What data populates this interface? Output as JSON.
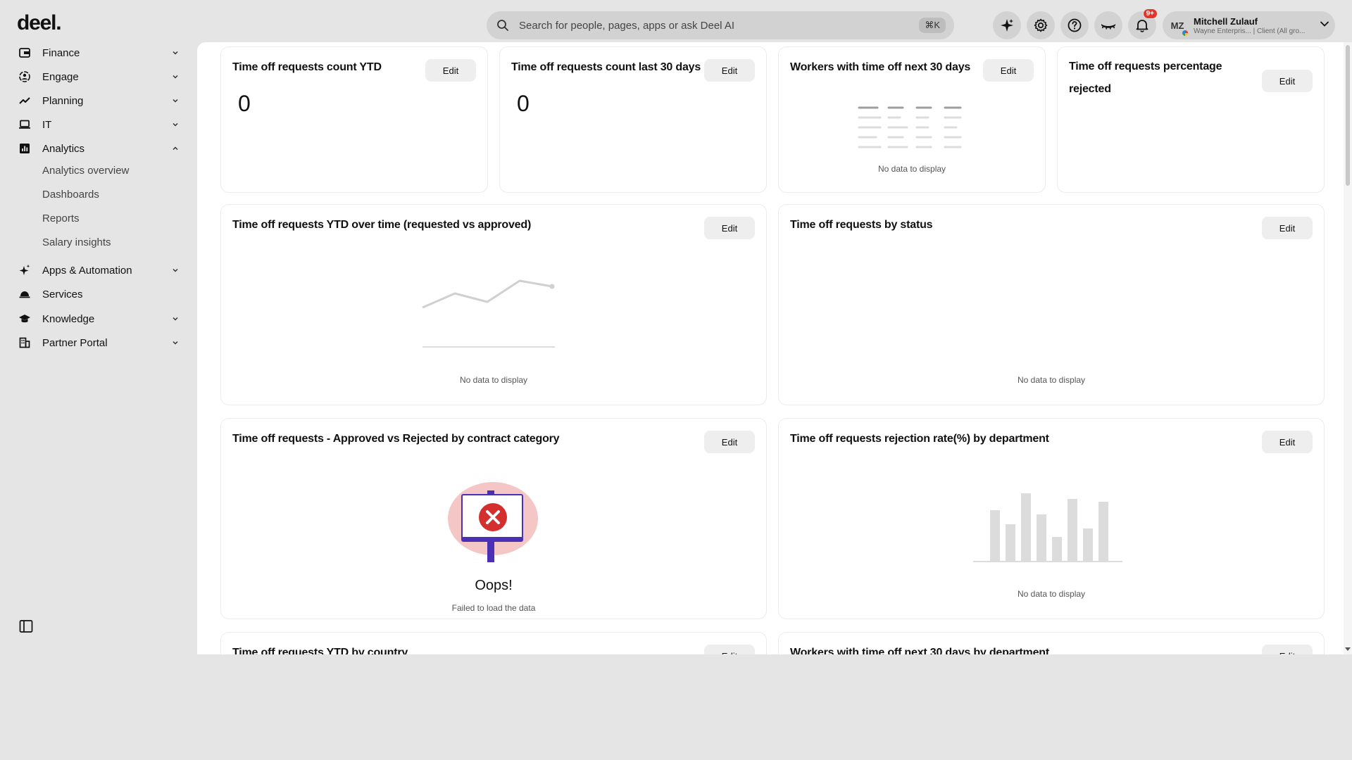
{
  "brand": {
    "logo": "deel."
  },
  "topbar": {
    "search_placeholder": "Search for people, pages, apps or ask Deel AI",
    "search_shortcut": "⌘K",
    "notification_count": "9+",
    "user": {
      "initials": "MZ",
      "name": "Mitchell Zulauf",
      "org": "Wayne Enterpris... | Client (All gro..."
    }
  },
  "sidebar": {
    "items": [
      {
        "label": "Finance",
        "icon": "finance-icon"
      },
      {
        "label": "Engage",
        "icon": "engage-icon"
      },
      {
        "label": "Planning",
        "icon": "trend-icon"
      },
      {
        "label": "IT",
        "icon": "laptop-icon"
      },
      {
        "label": "Analytics",
        "icon": "analytics-icon"
      },
      {
        "label": "Apps & Automation",
        "icon": "sparkle-icon"
      },
      {
        "label": "Services",
        "icon": "service-bell-icon"
      },
      {
        "label": "Knowledge",
        "icon": "graduation-cap-icon"
      },
      {
        "label": "Partner Portal",
        "icon": "building-icon"
      }
    ],
    "analytics_sub": [
      "Analytics overview",
      "Dashboards",
      "Reports",
      "Salary insights"
    ]
  },
  "cards": {
    "edit_label": "Edit",
    "no_data": "No data to display",
    "c1": {
      "title": "Time off requests count YTD",
      "value": "0"
    },
    "c2": {
      "title": "Time off requests count last 30 days",
      "value": "0"
    },
    "c3": {
      "title": "Workers with time off next 30 days"
    },
    "c4": {
      "title_line1": "Time off requests percentage",
      "title_line2": "rejected"
    },
    "c5": {
      "title": "Time off requests YTD over time (requested vs approved)"
    },
    "c6": {
      "title": "Time off requests by status"
    },
    "c7": {
      "title": "Time off requests - Approved vs Rejected by contract category",
      "oops": "Oops!",
      "fail": "Failed to load the data"
    },
    "c8": {
      "title": "Time off requests rejection rate(%) by department"
    },
    "c9": {
      "title": "Time off requests YTD by country"
    },
    "c10": {
      "title": "Workers with time off next 30 days by department"
    }
  },
  "colors": {
    "accent": "#e5352b",
    "purple": "#4b2fb5",
    "pink": "#f5c6c6"
  }
}
